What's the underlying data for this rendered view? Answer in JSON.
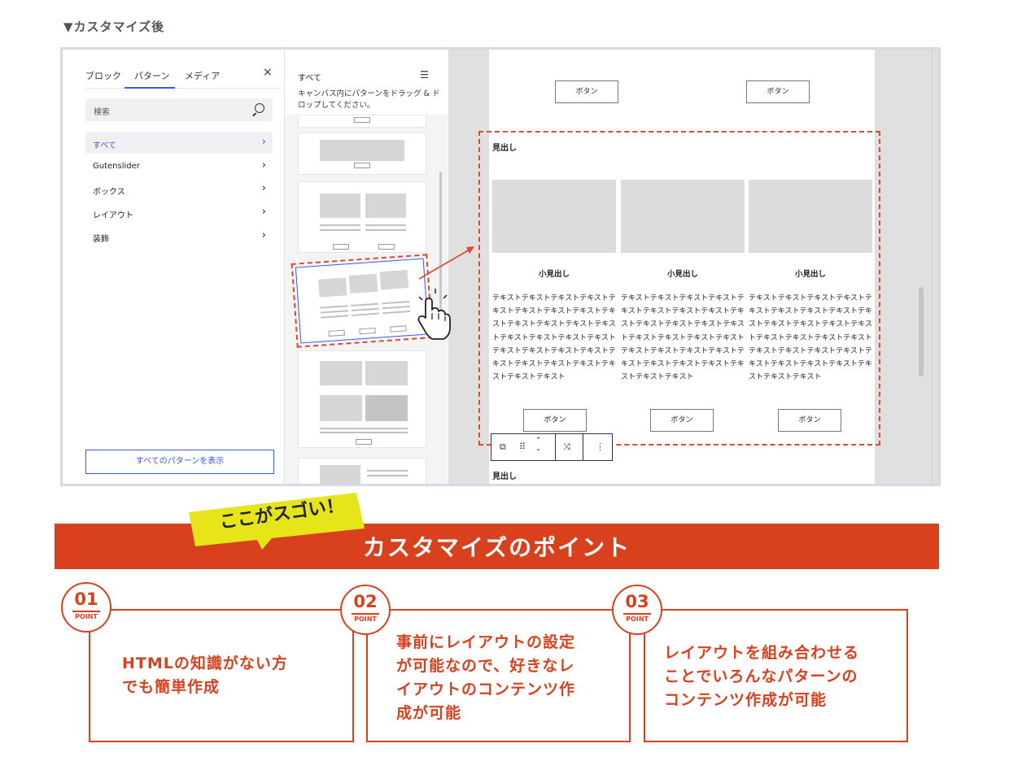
{
  "caption": "▼カスタマイズ後",
  "sidebar": {
    "tabs": [
      "ブロック",
      "パターン",
      "メディア"
    ],
    "close": "×",
    "search_placeholder": "検索",
    "categories": [
      "すべて",
      "Gutenslider",
      "ボックス",
      "レイアウト",
      "装飾"
    ],
    "show_all_button": "すべてのパターンを表示"
  },
  "pattern_panel": {
    "title": "すべて",
    "description": "キャンバス内にパターンをドラッグ & ドロップしてください。"
  },
  "canvas": {
    "top_buttons": [
      "ボタン",
      "ボタン"
    ],
    "heading": "見出し",
    "columns": [
      {
        "subheading": "小見出し",
        "text": "テキストテキストテキストテキストテキストテキストテキストテキストテキストテキストテキストテキストテキストテキストテキストテキストテキストテキストテキストテキストテキストテキストテキストテキストテキストテキストテキストテキスト",
        "button": "ボタン"
      },
      {
        "subheading": "小見出し",
        "text": "テキストテキストテキストテキストテキストテキストテキストテキストテキストテキストテキストテキストテキストテキストテキストテキストテキストテキストテキストテキストテキストテキストテキストテキストテキストテキストテキストテキスト",
        "button": "ボタン"
      },
      {
        "subheading": "小見出し",
        "text": "テキストテキストテキストテキストテキストテキストテキストテキストテキストテキストテキストテキストテキストテキストテキストテキストテキストテキストテキストテキストテキストテキストテキストテキストテキストテキストテキストテキスト",
        "button": "ボタン"
      }
    ],
    "next_heading": "見出し"
  },
  "banner": {
    "sticker": "ここがスゴい！",
    "title": "カスタマイズのポイント"
  },
  "points": [
    {
      "number": "01",
      "label": "POINT",
      "lines": [
        "HTMLの知識がない方",
        "でも簡単作成"
      ]
    },
    {
      "number": "02",
      "label": "POINT",
      "lines": [
        "事前にレイアウトの設定",
        "が可能なので、好きなレ",
        "イアウトのコンテンツ作",
        "成が可能"
      ]
    },
    {
      "number": "03",
      "label": "POINT",
      "lines": [
        "レイアウトを組み合わせる",
        "ことでいろんなパターンの",
        "コンテンツ作成が可能"
      ]
    }
  ],
  "colors": {
    "accent": "#d9411e",
    "wp_blue": "#3858e9",
    "sticker": "#e5e51a"
  }
}
